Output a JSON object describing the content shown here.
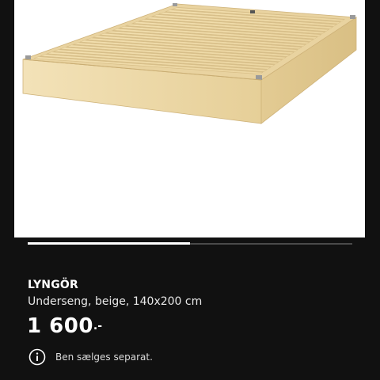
{
  "product": {
    "name": "LYNGÖR",
    "description": "Underseng, beige, 140x200 cm",
    "price_main": "1 600",
    "price_suffix": ".-",
    "note": "Ben sælges separat."
  },
  "carousel": {
    "progress": 0.5
  },
  "icons": {
    "info": "info-icon"
  },
  "colors": {
    "background": "#111111",
    "text_primary": "#ffffff",
    "progress_track": "#4a4a4a",
    "progress_fill": "#ffffff"
  }
}
